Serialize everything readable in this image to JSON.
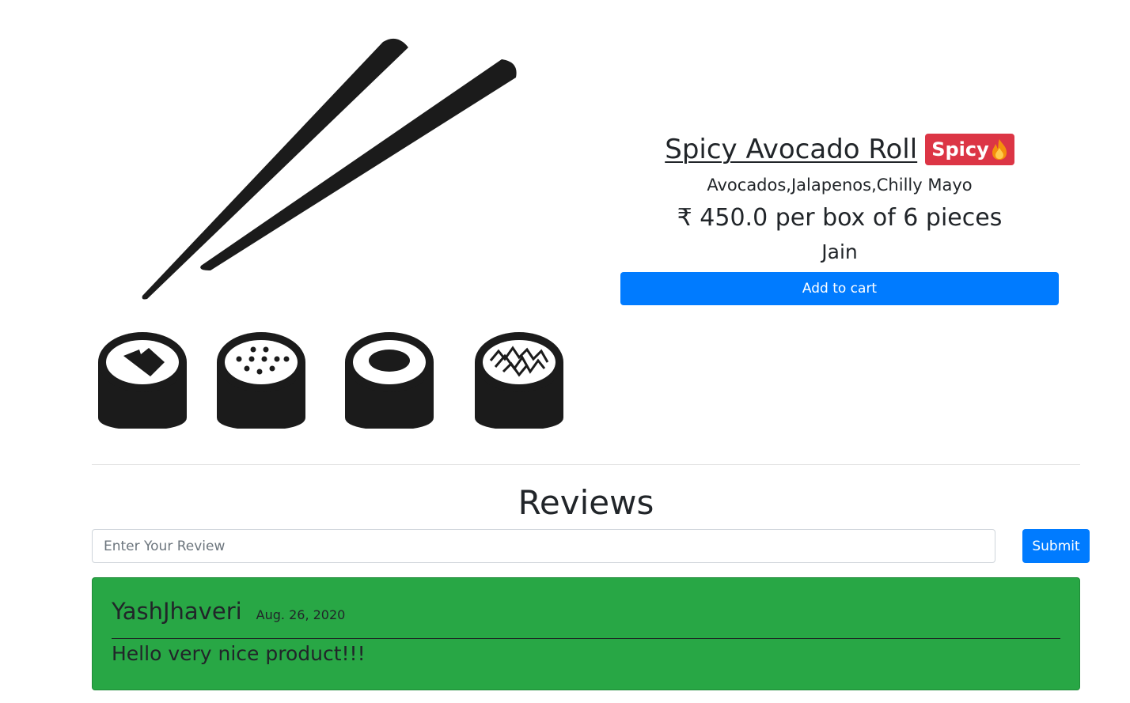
{
  "product": {
    "name": "Spicy Avocado Roll",
    "badge_label": "Spicy",
    "badge_icon": "fire-icon",
    "ingredients": "Avocados,Jalapenos,Chilly Mayo",
    "price": "₹ 450.0 per box of 6 pieces",
    "diet": "Jain",
    "add_to_cart_label": "Add to cart",
    "image_icon": "sushi-chopsticks-icon"
  },
  "reviews": {
    "heading": "Reviews",
    "input_placeholder": "Enter Your Review",
    "input_value": "",
    "submit_label": "Submit",
    "items": [
      {
        "author": "YashJhaveri",
        "date": "Aug. 26, 2020",
        "text": "Hello very nice product!!!"
      }
    ]
  },
  "colors": {
    "primary": "#007bff",
    "danger": "#dc3545",
    "success": "#28a745",
    "text": "#212529"
  }
}
